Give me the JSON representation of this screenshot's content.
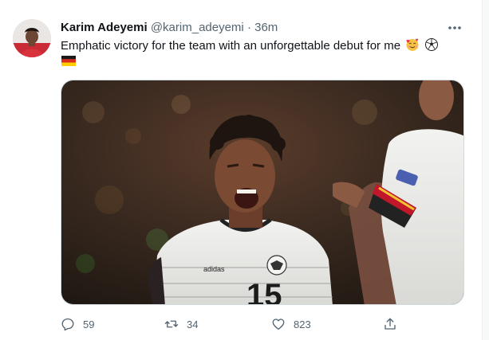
{
  "tweet": {
    "author_name": "Karim Adeyemi",
    "author_handle": "@karim_adeyemi",
    "separator": "·",
    "time_ago": "36m",
    "text": "Emphatic victory for the team with an unforgettable debut for me",
    "emojis": [
      "smiling-face-with-hearts",
      "soccer-ball",
      "germany-flag"
    ],
    "image_alt": "player jersey number",
    "jersey_number": "15",
    "jersey_brand": "adidas"
  },
  "actions": {
    "reply_count": "59",
    "retweet_count": "34",
    "like_count": "823"
  },
  "colors": {
    "text_primary": "#0f1419",
    "text_secondary": "#536471",
    "border": "#cfd9de"
  }
}
